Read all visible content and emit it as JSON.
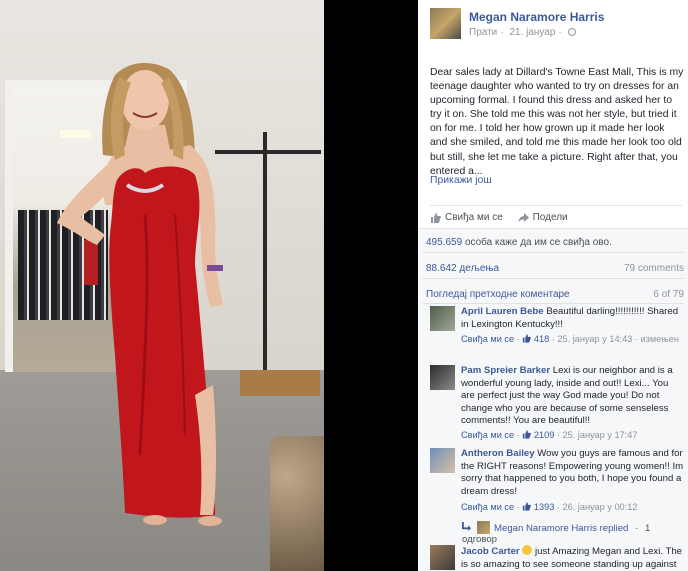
{
  "post": {
    "author": "Megan Naramore Harris",
    "follow_label": "Прати",
    "date": "21. јануар",
    "text": "Dear sales lady at Dillard's Towne East Mall, This is my teenage daughter who wanted to try on dresses for an upcoming formal. I found this dress and asked her to try it on. She told me this was not her style, but tried it on for me. I told her how grown up it made her look and she smiled, and told me this made her look too old but still, she let me take a picture. Right after that, you entered a...",
    "see_more": "Прикажи још",
    "like_action": "Свиђа ми се",
    "share_action": "Подели"
  },
  "stats": {
    "likes_count": "495.659",
    "likes_suffix": "особа каже да им се свиђа ово.",
    "shares": "88.642 дељења",
    "comments_total": "79 comments",
    "view_previous": "Погледај претходне коментаре",
    "shown_count": "6 of 79"
  },
  "comments": [
    {
      "name": "April Lauren Bebe",
      "text": "Beautiful darling!!!!!!!!!!! Shared in Lexington Kentucky!!!",
      "like_label": "Свиђа ми се",
      "likes": "418",
      "time": "25. јануар у 14:43",
      "edited": "измењен"
    },
    {
      "name": "Pam Spreier Barker",
      "text": "Lexi is our neighbor and is a wonderful young lady, inside and out!! Lexi... You are perfect just the way God made you! Do not change who you are because of some senseless comments!! You are beautiful!!",
      "like_label": "Свиђа ми се",
      "likes": "2109",
      "time": "25. јануар у 17:47"
    },
    {
      "name": "Antheron Bailey",
      "text": "Wow you guys are famous and for the RIGHT reasons! Empowering young women!! Im sorry that happened to you both, I hope you found a dream dress!",
      "like_label": "Свиђа ми се",
      "likes": "1393",
      "time": "26. јануар у 00:12"
    },
    {
      "name": "Jacob Carter",
      "text": "just Amazing Megan and Lexi. The is so amazing to see someone standing up against"
    }
  ],
  "reply": {
    "author": "Megan Naramore Harris",
    "action": "replied",
    "count": "1 одговор"
  },
  "colors": {
    "link_blue": "#3b5998",
    "dress_red": "#c0161c",
    "meta_gray": "#90949c"
  }
}
